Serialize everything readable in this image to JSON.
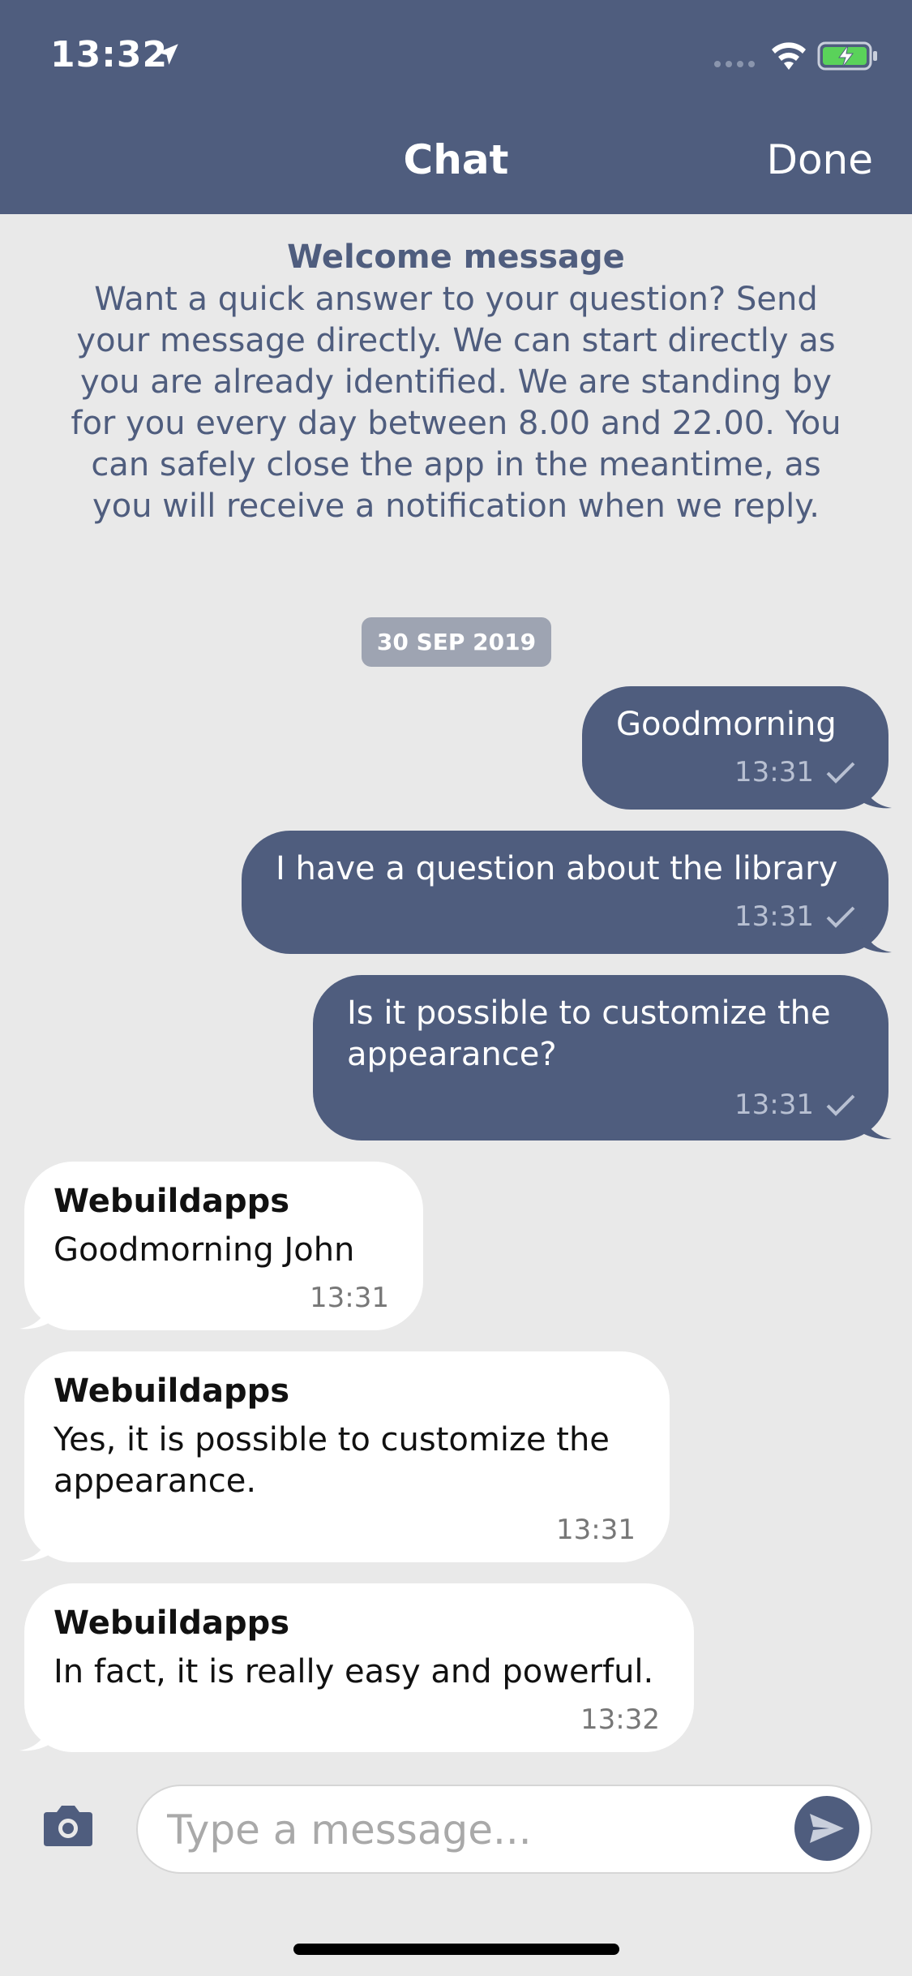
{
  "status": {
    "time": "13:32"
  },
  "nav": {
    "title": "Chat",
    "done_label": "Done"
  },
  "welcome": {
    "title": "Welcome message",
    "body": "Want a quick answer to your question? Send your message directly. We can start directly as you are already identified. We are standing by for you every day between 8.00 and 22.00. You can safely close the app in the meantime, as you will receive a notification when we reply."
  },
  "date_chip": "30 SEP 2019",
  "messages": [
    {
      "direction": "out",
      "text": "Goodmorning",
      "time": "13:31"
    },
    {
      "direction": "out",
      "text": "I have a question about the library",
      "time": "13:31"
    },
    {
      "direction": "out",
      "text": "Is it possible to customize the appearance?",
      "time": "13:31"
    },
    {
      "direction": "in",
      "sender": "Webuildapps",
      "text": "Goodmorning John",
      "time": "13:31"
    },
    {
      "direction": "in",
      "sender": "Webuildapps",
      "text": "Yes, it is possible to customize the appearance.",
      "time": "13:31"
    },
    {
      "direction": "in",
      "sender": "Webuildapps",
      "text": "In fact, it is really easy and powerful.",
      "time": "13:32"
    }
  ],
  "composer": {
    "placeholder": "Type a message..."
  },
  "colors": {
    "accent": "#4f5d7e",
    "background": "#e9e9e9",
    "incoming": "#ffffff",
    "date_chip": "#9ea4b2"
  },
  "icons": [
    "location-arrow-icon",
    "signal-icon",
    "wifi-icon",
    "battery-charging-icon",
    "check-icon",
    "camera-icon",
    "send-icon"
  ]
}
